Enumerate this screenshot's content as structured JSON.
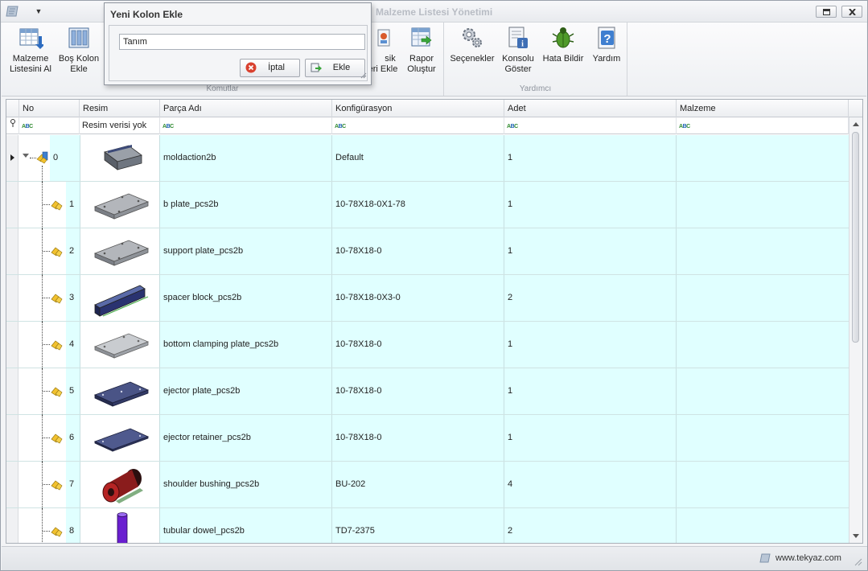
{
  "window": {
    "title": "Malzeme Listesi Yönetimi"
  },
  "ribbon": {
    "groups": [
      {
        "label": "Komutlar"
      },
      {
        "label": "Yardımcı"
      }
    ],
    "buttons": {
      "malzeme_listesi": [
        "Malzeme",
        "Listesini Al"
      ],
      "bos_kolon": [
        "Boş Kolon",
        "Ekle"
      ],
      "sik_eri": [
        "sik",
        "eri Ekle"
      ],
      "rapor": [
        "Rapor",
        "Oluştur"
      ],
      "secenekler": [
        "Seçenekler"
      ],
      "konsolu": [
        "Konsolu",
        "Göster"
      ],
      "hata": [
        "Hata Bildir"
      ],
      "yardim": [
        "Yardım"
      ]
    }
  },
  "dialog": {
    "title": "Yeni Kolon Ekle",
    "input_value": "Tanım",
    "cancel_label": "İptal",
    "add_label": "Ekle"
  },
  "grid": {
    "columns": [
      "No",
      "Resim",
      "Parça Adı",
      "Konfigürasyon",
      "Adet",
      "Malzeme"
    ],
    "filter_resim": "Resim verisi yok",
    "rows": [
      {
        "no": "0",
        "part": "moldaction2b",
        "config": "Default",
        "qty": "1",
        "material": "",
        "thumb": "assembly"
      },
      {
        "no": "1",
        "part": "b plate_pcs2b",
        "config": "10-78X18-0X1-78",
        "qty": "1",
        "material": "",
        "thumb": "grey-plate"
      },
      {
        "no": "2",
        "part": "support plate_pcs2b",
        "config": "10-78X18-0",
        "qty": "1",
        "material": "",
        "thumb": "grey-plate"
      },
      {
        "no": "3",
        "part": "spacer block_pcs2b",
        "config": "10-78X18-0X3-0",
        "qty": "2",
        "material": "",
        "thumb": "spacer"
      },
      {
        "no": "4",
        "part": "bottom clamping plate_pcs2b",
        "config": "10-78X18-0",
        "qty": "1",
        "material": "",
        "thumb": "grey-plate-light"
      },
      {
        "no": "5",
        "part": "ejector plate_pcs2b",
        "config": "10-78X18-0",
        "qty": "1",
        "material": "",
        "thumb": "blue-plate"
      },
      {
        "no": "6",
        "part": "ejector retainer_pcs2b",
        "config": "10-78X18-0",
        "qty": "1",
        "material": "",
        "thumb": "blue-plate-thin"
      },
      {
        "no": "7",
        "part": "shoulder bushing_pcs2b",
        "config": "BU-202",
        "qty": "4",
        "material": "",
        "thumb": "bushing"
      },
      {
        "no": "8",
        "part": "tubular dowel_pcs2b",
        "config": "TD7-2375",
        "qty": "2",
        "material": "",
        "thumb": "dowel"
      }
    ]
  },
  "statusbar": {
    "url": "www.tekyaz.com"
  },
  "colors": {
    "row_bg": "#e0ffff",
    "accent": "#1a5fb4"
  }
}
